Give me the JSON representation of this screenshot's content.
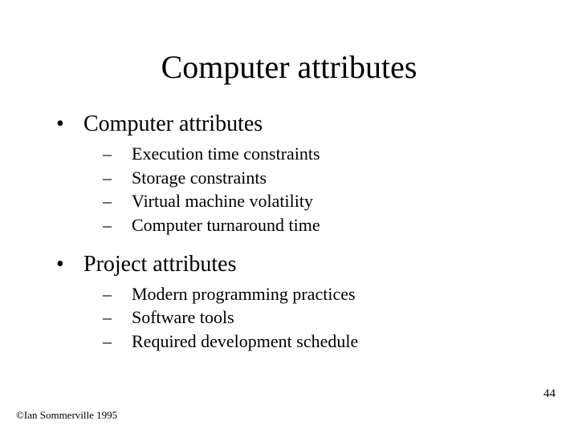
{
  "title": "Computer attributes",
  "bullets": [
    {
      "label": "Computer attributes",
      "subitems": [
        "Execution time constraints",
        "Storage constraints",
        "Virtual machine volatility",
        "Computer turnaround time"
      ]
    },
    {
      "label": "Project attributes",
      "subitems": [
        "Modern programming practices",
        "Software tools",
        "Required development schedule"
      ]
    }
  ],
  "page_number": "44",
  "footer": "©Ian Sommerville 1995"
}
